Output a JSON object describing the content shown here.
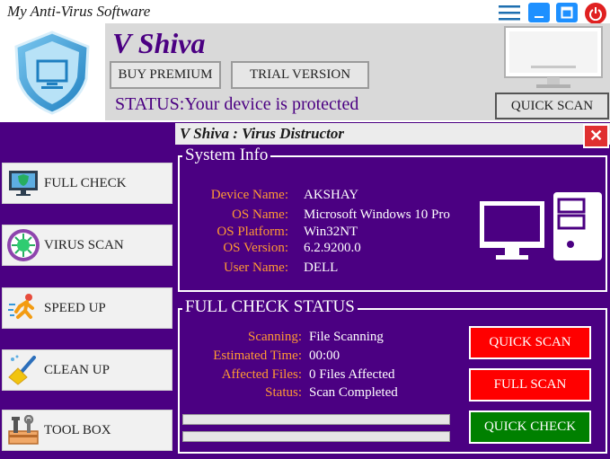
{
  "window": {
    "title": "My Anti-Virus Software"
  },
  "header": {
    "brand": "V Shiva",
    "buy_label": "BUY PREMIUM",
    "trial_label": "TRIAL VERSION",
    "status_label": "STATUS:",
    "status_value": "Your device is protected",
    "quick_scan_label": "QUICK SCAN"
  },
  "sidebar": {
    "items": [
      {
        "label": "FULL CHECK",
        "icon": "monitor-shield-icon"
      },
      {
        "label": "VIRUS SCAN",
        "icon": "virus-icon"
      },
      {
        "label": "SPEED UP",
        "icon": "runner-icon"
      },
      {
        "label": "CLEAN UP",
        "icon": "broom-icon"
      },
      {
        "label": "TOOL BOX",
        "icon": "toolbox-icon"
      }
    ]
  },
  "main": {
    "title": "V Shiva : Virus Distructor",
    "system_info": {
      "legend": "System Info",
      "rows": [
        {
          "label": "Device Name:",
          "value": "AKSHAY"
        },
        {
          "label": "OS Name:",
          "value": "Microsoft Windows 10 Pro"
        },
        {
          "label": "OS Platform:",
          "value": "Win32NT"
        },
        {
          "label": "OS Version:",
          "value": "6.2.9200.0"
        },
        {
          "label": "User Name:",
          "value": "DELL"
        }
      ]
    },
    "full_check": {
      "legend": "FULL CHECK STATUS",
      "rows": [
        {
          "label": "Scanning:",
          "value": "File Scanning"
        },
        {
          "label": "Estimated Time:",
          "value": "00:00"
        },
        {
          "label": "Affected Files:",
          "value": "0 Files Affected"
        },
        {
          "label": "Status:",
          "value": "Scan Completed"
        }
      ],
      "buttons": {
        "quick_scan": "QUICK SCAN",
        "full_scan": "FULL SCAN",
        "quick_check": "QUICK CHECK"
      }
    }
  },
  "colors": {
    "primary": "#4b0082",
    "accent_label": "#ff9933",
    "danger": "#ff0000",
    "success": "#008000"
  }
}
